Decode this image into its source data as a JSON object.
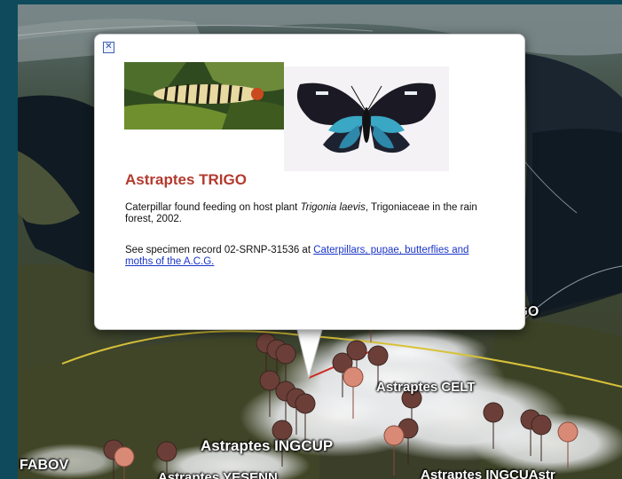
{
  "map": {
    "labels": {
      "trigo": "IGO",
      "celt": "Astraptes CELT",
      "ingcup": "Astraptes INGCUP",
      "fabov": "FABOV",
      "yesenn": "Astraptes YESENN",
      "ingcup2": "Astraptes INGCUAstr"
    },
    "colors": {
      "ocean": "#0e4a5c",
      "pin_dark": "#6b3f38",
      "pin_light": "#d98a76",
      "boundary_line": "#d8c23a",
      "connector_line": "#d02a20"
    }
  },
  "balloon": {
    "close_icon": "close-x-icon",
    "title": "Astraptes TRIGO",
    "title_color": "#b33a2e",
    "description_prefix": "Caterpillar found feeding on host plant ",
    "host_plant": "Trigonia laevis",
    "description_suffix": ", Trigoniaceae in the rain forest, 2002.",
    "record_prefix": "See specimen record 02-SRNP-31536 at ",
    "record_link": "Caterpillars, pupae, butterflies and moths of the A.C.G.",
    "record_suffix": ""
  }
}
